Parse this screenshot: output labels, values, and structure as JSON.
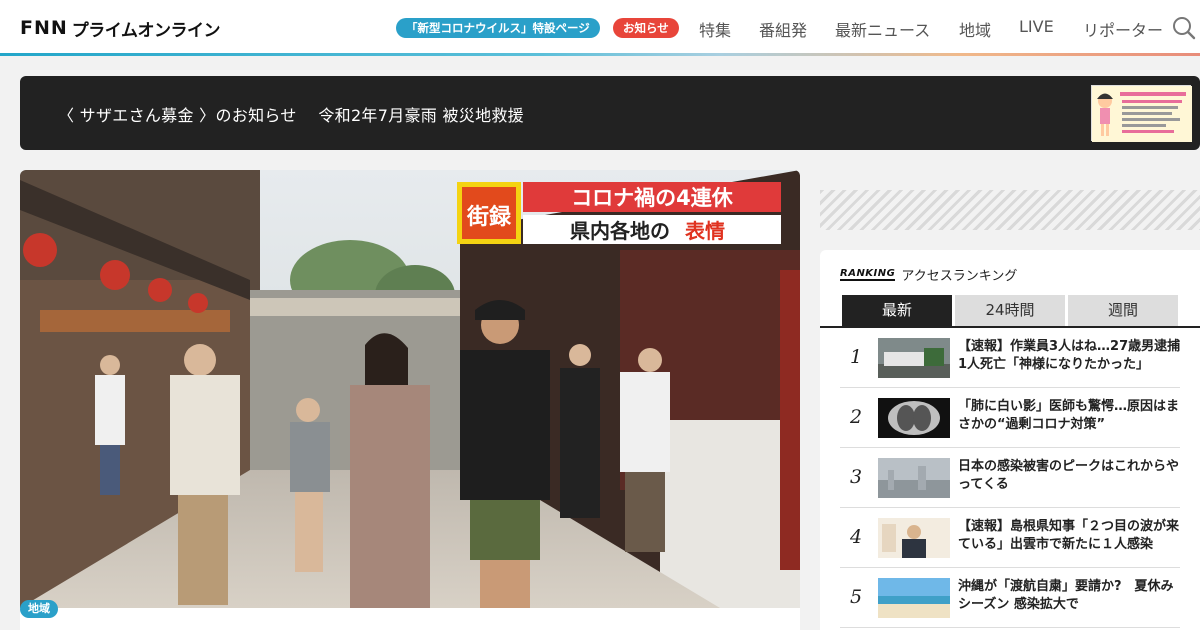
{
  "header": {
    "logo_fnn": "FNN",
    "logo_text": "プライムオンライン",
    "pill_corona": "「新型コロナウイルス」特設ページ",
    "pill_notice": "お知らせ",
    "nav": [
      {
        "label": "特集"
      },
      {
        "label": "番組発"
      },
      {
        "label": "最新ニュース"
      },
      {
        "label": "地域"
      },
      {
        "label": "LIVE"
      },
      {
        "label": "リポーター"
      }
    ],
    "search_icon": "search-icon"
  },
  "banner": {
    "text": "〈 サザエさん募金 〉のお知らせ　 令和2年7月豪雨 被災地救援"
  },
  "hero": {
    "overlay_tag": "街録",
    "overlay_title": "コロナ禍の4連休",
    "overlay_sub_prefix": "県内各地の",
    "overlay_sub_highlight": "表情",
    "category": "地域"
  },
  "ranking": {
    "label": "RANKING",
    "title": "アクセスランキング",
    "tabs": [
      {
        "label": "最新",
        "active": true
      },
      {
        "label": "24時間",
        "active": false
      },
      {
        "label": "週間",
        "active": false
      }
    ],
    "items": [
      {
        "rank": "1",
        "title": "【速報】作業員3人はね…27歳男逮捕　1人死亡「神様になりたかった」"
      },
      {
        "rank": "2",
        "title": "「肺に白い影」医師も驚愕…原因はまさかの“過剰コロナ対策”"
      },
      {
        "rank": "3",
        "title": "日本の感染被害のピークはこれからやってくる"
      },
      {
        "rank": "4",
        "title": "【速報】島根県知事「２つ目の波が来ている」出雲市で新たに１人感染"
      },
      {
        "rank": "5",
        "title": "沖縄が「渡航自粛」要請か?　夏休みシーズン 感染拡大で"
      }
    ]
  },
  "colors": {
    "accent_blue": "#2aa0c9",
    "accent_red": "#e8453a",
    "banner_bg": "#222222"
  }
}
